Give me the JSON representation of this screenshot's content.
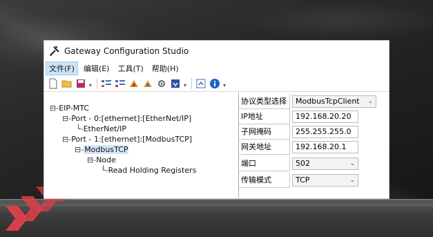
{
  "window": {
    "title": "Gateway Configuration Studio"
  },
  "menu": [
    {
      "label": "文件(F)",
      "active": true
    },
    {
      "label": "编辑(E)"
    },
    {
      "label": "工具(T)"
    },
    {
      "label": "帮助(H)"
    }
  ],
  "toolbar": {
    "icons": [
      "new-file-icon",
      "open-folder-icon",
      "save-icon",
      "add-port-icon",
      "remove-port-icon",
      "add-node-icon",
      "remove-node-icon",
      "settings-gear-icon",
      "download-icon",
      "upload-icon",
      "info-icon"
    ]
  },
  "tree": {
    "root": "EIP-MTC",
    "port0": "Port - 0:[ethernet]:[EtherNet/IP]",
    "port0_child": "EtherNet/IP",
    "port1": "Port - 1:[ethernet]:[ModbusTCP]",
    "modbus": "ModbusTCP",
    "node": "Node",
    "registers": "Read Holding Registers"
  },
  "props": {
    "protocol": {
      "label": "协议类型选择",
      "value": "ModbusTcpClient"
    },
    "ip": {
      "label": "IP地址",
      "value": "192.168.20.20"
    },
    "mask": {
      "label": "子网掩码",
      "value": "255.255.255.0"
    },
    "gateway": {
      "label": "网关地址",
      "value": "192.168.20.1"
    },
    "port": {
      "label": "端口",
      "value": "502"
    },
    "mode": {
      "label": "传输模式",
      "value": "TCP"
    }
  },
  "colors": {
    "selection": "#cce4f7",
    "chevron": "#e0404a"
  }
}
